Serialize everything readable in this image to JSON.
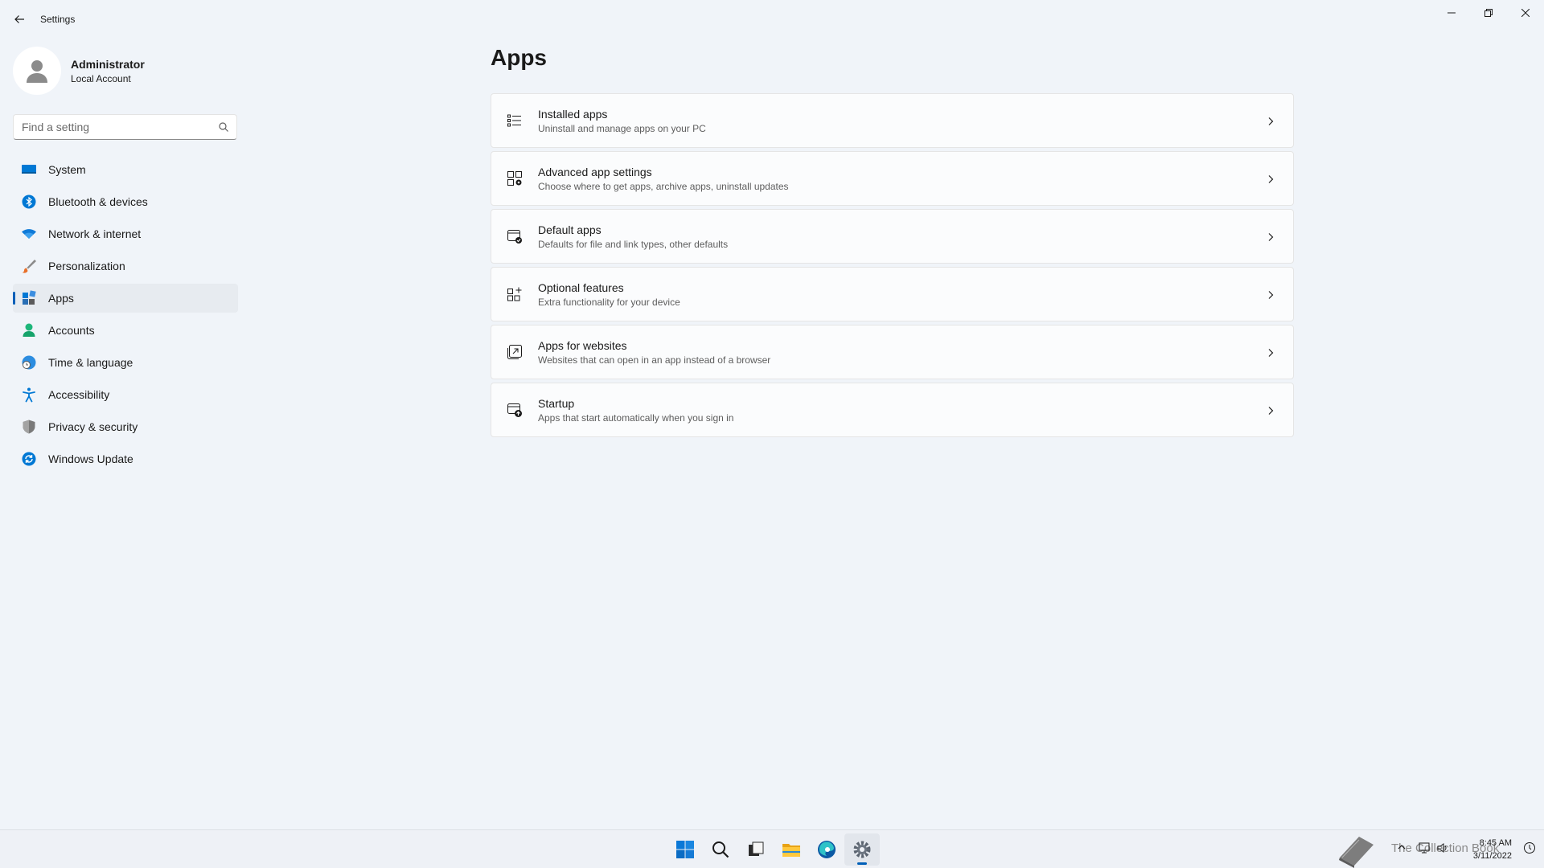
{
  "window": {
    "title": "Settings"
  },
  "profile": {
    "name": "Administrator",
    "account_type": "Local Account"
  },
  "search": {
    "placeholder": "Find a setting"
  },
  "sidebar": {
    "items": [
      {
        "label": "System",
        "icon": "system-icon"
      },
      {
        "label": "Bluetooth & devices",
        "icon": "bluetooth-icon"
      },
      {
        "label": "Network & internet",
        "icon": "wifi-icon"
      },
      {
        "label": "Personalization",
        "icon": "brush-icon"
      },
      {
        "label": "Apps",
        "icon": "apps-icon",
        "selected": true
      },
      {
        "label": "Accounts",
        "icon": "person-icon"
      },
      {
        "label": "Time & language",
        "icon": "globe-clock-icon"
      },
      {
        "label": "Accessibility",
        "icon": "accessibility-icon"
      },
      {
        "label": "Privacy & security",
        "icon": "shield-icon"
      },
      {
        "label": "Windows Update",
        "icon": "update-icon"
      }
    ]
  },
  "main": {
    "title": "Apps",
    "cards": [
      {
        "title": "Installed apps",
        "subtitle": "Uninstall and manage apps on your PC",
        "icon": "list-icon"
      },
      {
        "title": "Advanced app settings",
        "subtitle": "Choose where to get apps, archive apps, uninstall updates",
        "icon": "app-settings-icon"
      },
      {
        "title": "Default apps",
        "subtitle": "Defaults for file and link types, other defaults",
        "icon": "default-apps-icon"
      },
      {
        "title": "Optional features",
        "subtitle": "Extra functionality for your device",
        "icon": "optional-features-icon"
      },
      {
        "title": "Apps for websites",
        "subtitle": "Websites that can open in an app instead of a browser",
        "icon": "open-external-icon"
      },
      {
        "title": "Startup",
        "subtitle": "Apps that start automatically when you sign in",
        "icon": "startup-icon"
      }
    ]
  },
  "taskbar": {
    "watermark": "The Collection Book",
    "time": "8:45 AM",
    "date": "3/11/2022"
  },
  "colors": {
    "accent": "#005fb8",
    "background": "#f0f4f9",
    "card": "#fbfcfd"
  }
}
